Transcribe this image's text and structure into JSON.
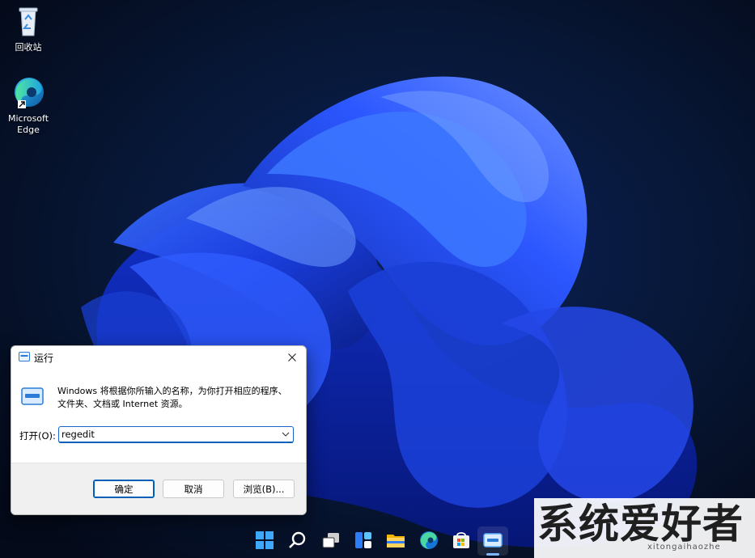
{
  "desktop": {
    "icons": [
      {
        "label": "回收站",
        "icon": "recycle-bin-icon"
      },
      {
        "label_line1": "Microsoft",
        "label_line2": "Edge",
        "icon": "edge-icon"
      }
    ]
  },
  "run_dialog": {
    "title": "运行",
    "description": "Windows 将根据你所输入的名称，为你打开相应的程序、文件夹、文档或 Internet 资源。",
    "open_label": "打开(O):",
    "open_value": "regedit",
    "buttons": {
      "ok": "确定",
      "cancel": "取消",
      "browse": "浏览(B)..."
    },
    "accent_color": "#005fb8"
  },
  "taskbar": {
    "items": [
      "start-icon",
      "search-icon",
      "task-view-icon",
      "widgets-icon",
      "file-explorer-icon",
      "edge-icon",
      "store-icon",
      "run-app-icon"
    ]
  },
  "watermark": {
    "text": "系统爱好者",
    "sub": "xitongaihaozhe"
  }
}
